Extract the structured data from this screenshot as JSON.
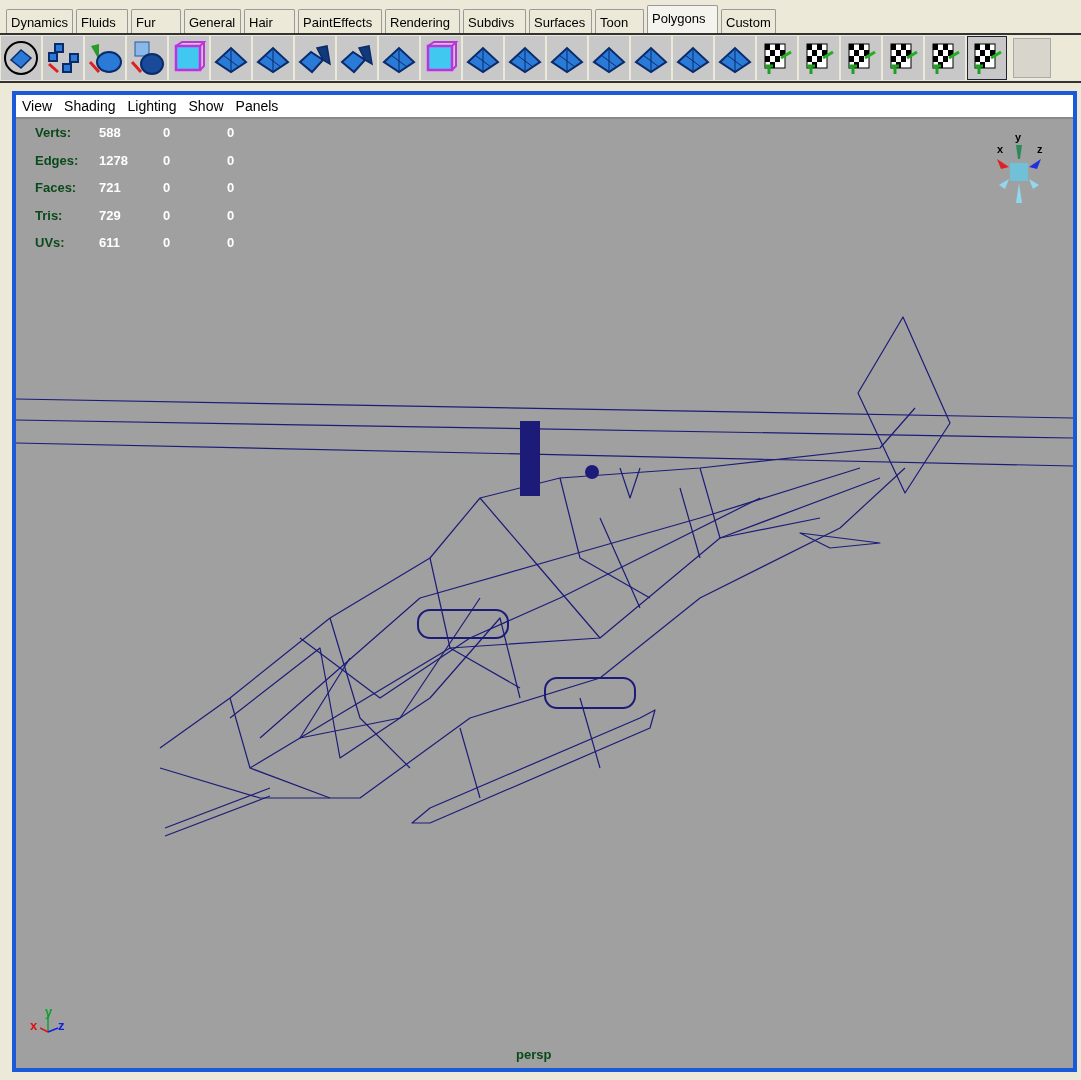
{
  "shelf_tabs": [
    {
      "label": "Dynamics",
      "selected": false
    },
    {
      "label": "Fluids",
      "selected": false
    },
    {
      "label": "Fur",
      "selected": false
    },
    {
      "label": "General",
      "selected": false
    },
    {
      "label": "Hair",
      "selected": false
    },
    {
      "label": "PaintEffects",
      "selected": false
    },
    {
      "label": "Rendering",
      "selected": false
    },
    {
      "label": "Subdivs",
      "selected": false
    },
    {
      "label": "Surfaces",
      "selected": false
    },
    {
      "label": "Toon",
      "selected": false
    },
    {
      "label": "Polygons",
      "selected": true
    },
    {
      "label": "Custom",
      "selected": false
    }
  ],
  "panel_menu": [
    "View",
    "Shading",
    "Lighting",
    "Show",
    "Panels"
  ],
  "heads_up_stats": [
    {
      "label": "Verts:",
      "values": [
        "588",
        "0",
        "0"
      ]
    },
    {
      "label": "Edges:",
      "values": [
        "1278",
        "0",
        "0"
      ]
    },
    {
      "label": "Faces:",
      "values": [
        "721",
        "0",
        "0"
      ]
    },
    {
      "label": "Tris:",
      "values": [
        "729",
        "0",
        "0"
      ]
    },
    {
      "label": "UVs:",
      "values": [
        "611",
        "0",
        "0"
      ]
    }
  ],
  "view_cube": {
    "labels": [
      "x",
      "y",
      "z"
    ]
  },
  "axis_indicator": {
    "labels": [
      "x",
      "y",
      "z"
    ]
  },
  "camera_name": "persp"
}
